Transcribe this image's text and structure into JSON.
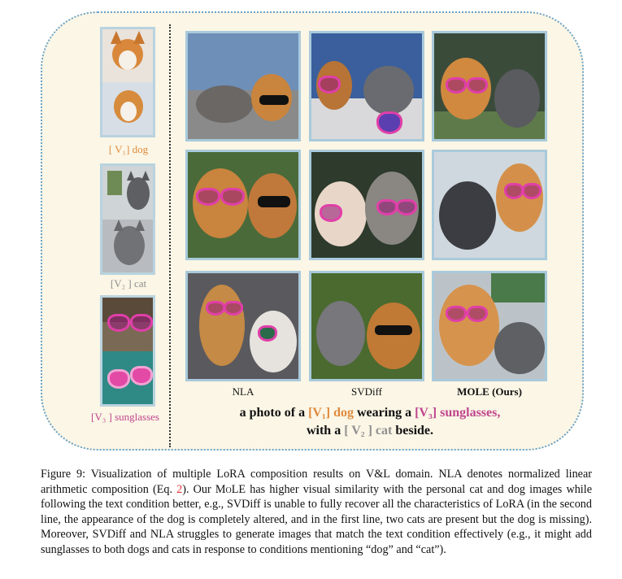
{
  "figure": {
    "references": [
      {
        "label": "[ V₁] dog",
        "icon": "dog-photo"
      },
      {
        "label": "[V₂ ] cat",
        "icon": "cat-photo"
      },
      {
        "label": "[V₃ ] sunglasses",
        "icon": "sunglasses-photo"
      }
    ],
    "columns": [
      "NLA",
      "SVDiff",
      "MOLE (Ours)"
    ],
    "prompt": {
      "line1_a": "a photo of a ",
      "v1": "[V₁] dog",
      "line1_b": " wearing a ",
      "v3": "[V₃] sunglasses,",
      "line2_a": "with a ",
      "v2": "[ V₂ ] cat",
      "line2_b": " beside."
    }
  },
  "caption": {
    "p1": "Figure 9: Visualization of multiple LoRA composition results on V&L domain. NLA denotes normalized linear arithmetic composition (Eq. ",
    "eq_ref": "2",
    "p2": "). Our M",
    "mole_sc": "o",
    "mole_le": "LE",
    "p3": " has higher visual similarity with the personal cat and dog images while following the text condition better, e.g., SVDiff is unable to fully recover all the characteristics of LoRA (in the second line, the appearance of the dog is completely altered, and in the first line, two cats are present but the dog is missing). Moreover, SVDiff and NLA struggles to generate images that match the text condition effectively (e.g., it might add sunglasses to both dogs and cats in response to conditions mentioning “dog” and “cat”)."
  },
  "colors": {
    "panel_bg": "#fbf6e6",
    "border": "#6aa3c8",
    "v1": "#e08a3c",
    "v2": "#8f8f8f",
    "v3": "#c0458e",
    "ref_link": "#dd3333"
  }
}
